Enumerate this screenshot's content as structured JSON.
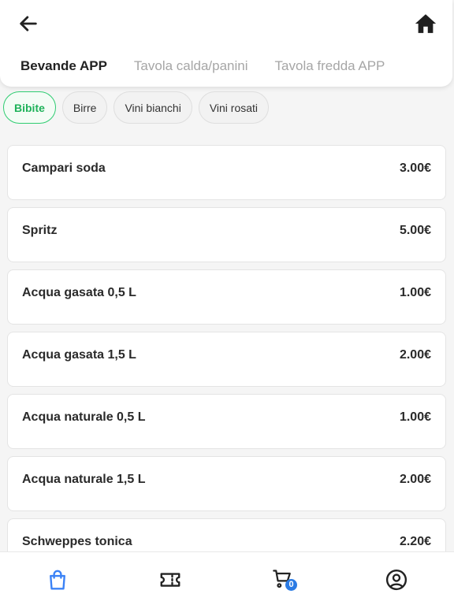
{
  "header": {
    "tabs": [
      {
        "label": "Bevande APP",
        "active": true
      },
      {
        "label": "Tavola calda/panini",
        "active": false
      },
      {
        "label": "Tavola fredda APP",
        "active": false
      }
    ]
  },
  "categories": [
    {
      "label": "Bibite",
      "active": true
    },
    {
      "label": "Birre",
      "active": false
    },
    {
      "label": "Vini bianchi",
      "active": false
    },
    {
      "label": "Vini rosati",
      "active": false
    }
  ],
  "products": [
    {
      "name": "Campari soda",
      "price": "3.00€"
    },
    {
      "name": "Spritz",
      "price": "5.00€"
    },
    {
      "name": "Acqua gasata 0,5 L",
      "price": "1.00€"
    },
    {
      "name": "Acqua gasata 1,5 L",
      "price": "2.00€"
    },
    {
      "name": "Acqua naturale 0,5 L",
      "price": "1.00€"
    },
    {
      "name": "Acqua naturale 1,5 L",
      "price": "2.00€"
    },
    {
      "name": "Schweppes tonica",
      "price": "2.20€"
    }
  ],
  "bottom_nav": {
    "items": [
      {
        "icon": "shopping-bag-icon",
        "active": true
      },
      {
        "icon": "ticket-icon",
        "active": false
      },
      {
        "icon": "cart-icon",
        "active": false
      },
      {
        "icon": "user-circle-icon",
        "active": false
      }
    ],
    "cart_count": "0"
  },
  "colors": {
    "accent_green": "#2ecc71",
    "active_nav_blue": "#3b82f6",
    "badge_blue": "#2b7be4"
  }
}
